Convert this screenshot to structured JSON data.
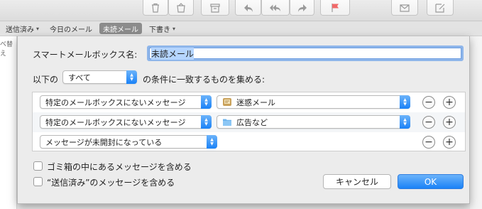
{
  "favorites_bar": {
    "items": [
      {
        "label": "送信済み",
        "has_menu": true,
        "active": false
      },
      {
        "label": "今日のメール",
        "has_menu": false,
        "active": false
      },
      {
        "label": "未読メール",
        "has_menu": false,
        "active": true
      },
      {
        "label": "下書き",
        "has_menu": true,
        "active": false
      }
    ],
    "truncated_sidebar_text": "べ替え"
  },
  "toolbar": {
    "icons": [
      "trash-icon",
      "junk-icon",
      "archive-icon",
      "reply-icon",
      "reply-all-icon",
      "forward-icon",
      "flag-icon",
      "compose-new-icon",
      "compose-edit-icon"
    ],
    "flag_color": "#f06a6a"
  },
  "dialog": {
    "name_label": "スマートメールボックス名:",
    "name_value": "未読メール",
    "match_prefix": "以下の",
    "match_option": "すべて",
    "match_suffix": "の条件に一致するものを集める:",
    "criteria": [
      {
        "field": "特定のメールボックスにないメッセージ",
        "value": "迷惑メール",
        "value_icon": "junk-mailbox-icon"
      },
      {
        "field": "特定のメールボックスにないメッセージ",
        "value": "広告など",
        "value_icon": "folder-icon"
      },
      {
        "field": "メッセージが未開封になっている",
        "value": null,
        "value_icon": null
      }
    ],
    "remove_glyph": "−",
    "add_glyph": "+",
    "include_trash_label": "ゴミ箱の中にあるメッセージを含める",
    "include_sent_label": "“送信済み”のメッセージを含める",
    "include_trash_checked": false,
    "include_sent_checked": false,
    "cancel_label": "キャンセル",
    "ok_label": "OK"
  },
  "colors": {
    "accent": "#1a82f7",
    "focus_ring": "#8fb6ea",
    "selection": "#b5d5ff",
    "active_favorite": "#8c8c8c"
  }
}
